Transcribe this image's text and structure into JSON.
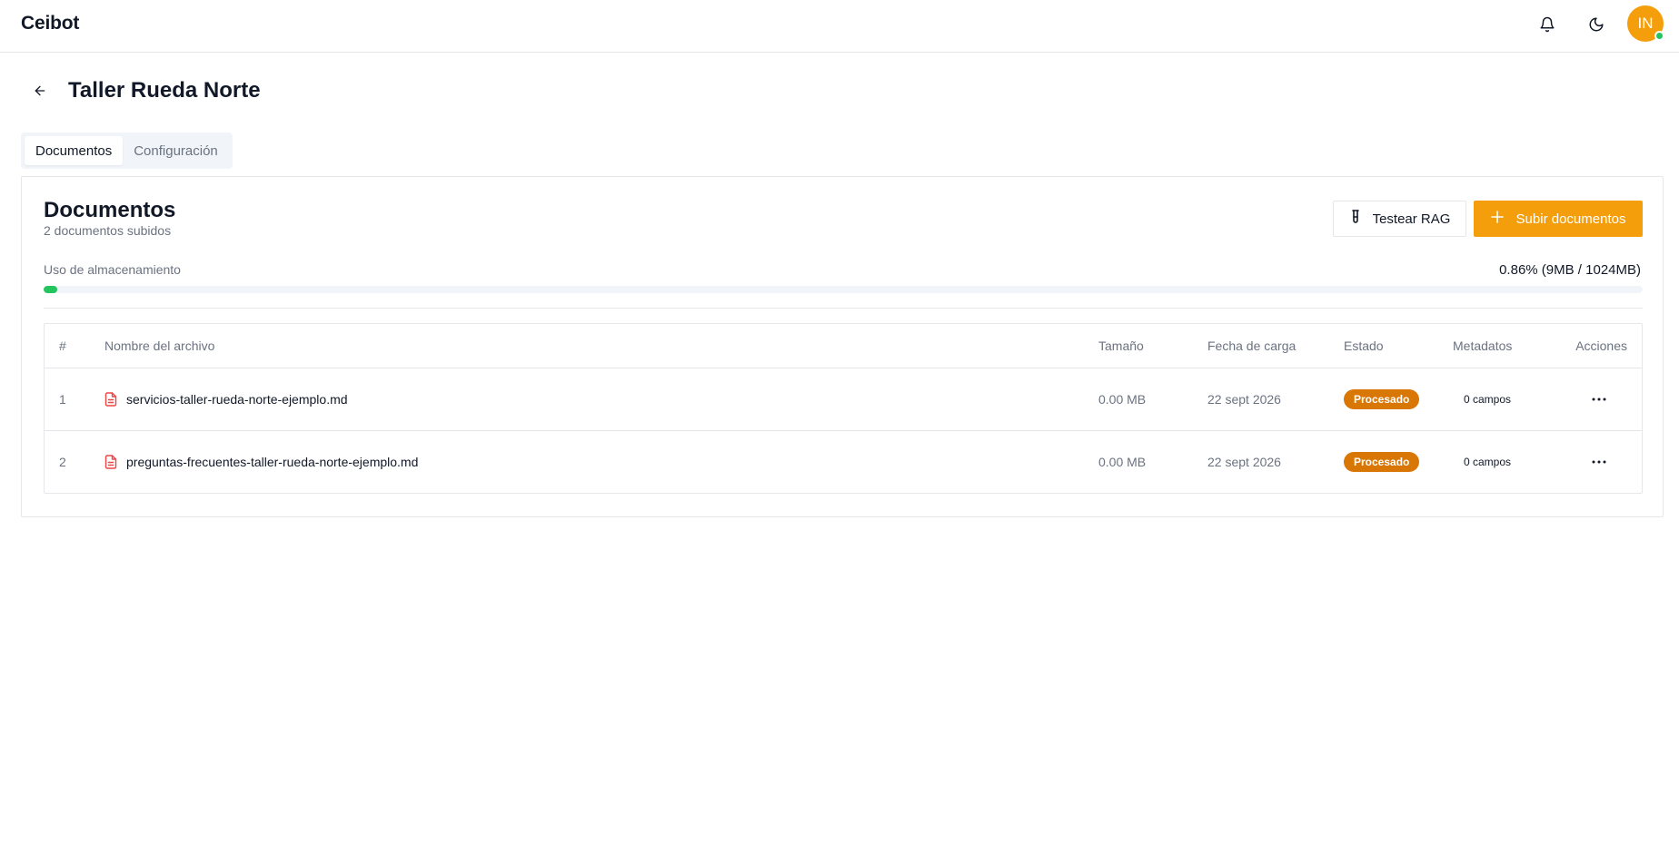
{
  "app": {
    "brand": "Ceibot",
    "avatar_initials": "IN"
  },
  "page": {
    "title": "Taller Rueda Norte"
  },
  "tabs": [
    {
      "label": "Documentos",
      "active": true
    },
    {
      "label": "Configuración",
      "active": false
    }
  ],
  "documents": {
    "title": "Documentos",
    "subtitle": "2 documentos subidos",
    "test_button": "Testear RAG",
    "upload_button": "Subir documentos",
    "storage_label": "Uso de almacenamiento",
    "storage_value": "0.86% (9MB / 1024MB)",
    "storage_fraction": 0.0086
  },
  "table": {
    "headers": {
      "num": "#",
      "name": "Nombre del archivo",
      "size": "Tamaño",
      "date": "Fecha de carga",
      "status": "Estado",
      "meta": "Metadatos",
      "actions": "Acciones"
    },
    "rows": [
      {
        "num": "1",
        "name": "servicios-taller-rueda-norte-ejemplo.md",
        "size": "0.00 MB",
        "date": "22 sept 2026",
        "status": "Procesado",
        "meta": "0 campos"
      },
      {
        "num": "2",
        "name": "preguntas-frecuentes-taller-rueda-norte-ejemplo.md",
        "size": "0.00 MB",
        "date": "22 sept 2026",
        "status": "Procesado",
        "meta": "0 campos"
      }
    ]
  },
  "colors": {
    "accent": "#f59e0b",
    "status_badge": "#d97706",
    "progress": "#22c55e",
    "file_icon": "#ef4444",
    "online": "#22c55e"
  },
  "icons": {
    "bell": "bell-icon",
    "theme": "moon-icon",
    "back": "arrow-left-icon",
    "test": "test-tube-icon",
    "upload": "plus-icon",
    "file": "file-text-icon",
    "actions": "more-horizontal-icon"
  }
}
